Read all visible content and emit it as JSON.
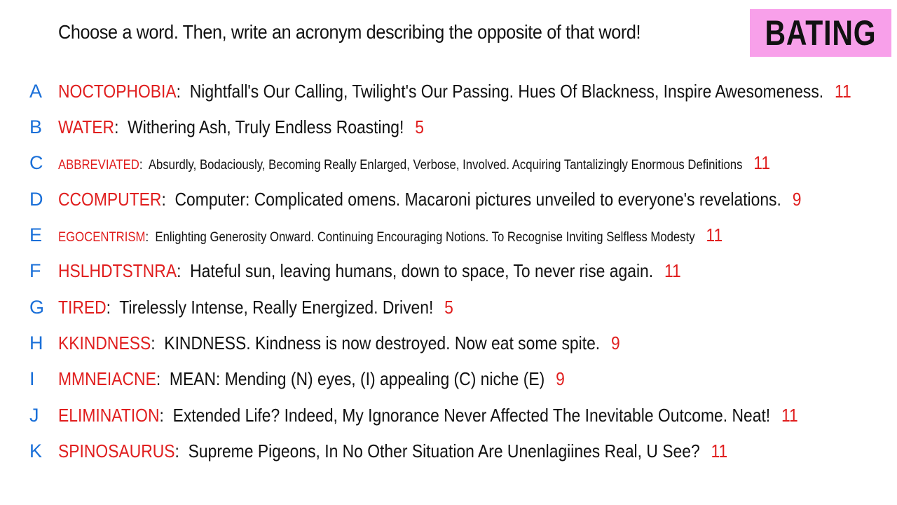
{
  "prompt": "Choose a word. Then, write an acronym describing the opposite of that word!",
  "badge": "BATING",
  "entries": [
    {
      "letter": "A",
      "word": "NOCTOPHOBIA",
      "text": "Nightfall's Our Calling, Twilight's Our Passing. Hues Of Blackness, Inspire Awesomeness.",
      "score": "11"
    },
    {
      "letter": "B",
      "word": "WATER",
      "text": "Withering Ash, Truly Endless Roasting!",
      "score": "5"
    },
    {
      "letter": "C",
      "word": "ABBREVIATED",
      "text": "Absurdly, Bodaciously, Becoming Really Enlarged, Verbose, Involved. Acquiring Tantalizingly Enormous Definitions",
      "score": "11"
    },
    {
      "letter": "D",
      "word": "CCOMPUTER",
      "text": "Computer: Complicated omens. Macaroni pictures unveiled to everyone's revelations.",
      "score": "9"
    },
    {
      "letter": "E",
      "word": "EGOCENTRISM",
      "text": "Enlighting Generosity Onward. Continuing Encouraging Notions. To Recognise Inviting Selfless Modesty",
      "score": "11"
    },
    {
      "letter": "F",
      "word": "HSLHDTSTNRA",
      "text": "Hateful sun, leaving humans, down to space, To never rise again.",
      "score": "11"
    },
    {
      "letter": "G",
      "word": "TIRED",
      "text": "Tirelessly Intense, Really Energized. Driven!",
      "score": "5"
    },
    {
      "letter": "H",
      "word": "KKINDNESS",
      "text": "KINDNESS. Kindness is now destroyed. Now eat some spite.",
      "score": "9"
    },
    {
      "letter": "I",
      "word": "MMNEIACNE",
      "text": "MEAN: Mending (N) eyes, (I) appealing (C) niche (E)",
      "score": "9"
    },
    {
      "letter": "J",
      "word": "ELIMINATION",
      "text": "Extended Life? Indeed, My Ignorance Never Affected The Inevitable Outcome. Neat!",
      "score": "11"
    },
    {
      "letter": "K",
      "word": "SPINOSAURUS",
      "text": "Supreme Pigeons, In No Other Situation Are Unenlagiines Real, U See?",
      "score": "11"
    }
  ]
}
